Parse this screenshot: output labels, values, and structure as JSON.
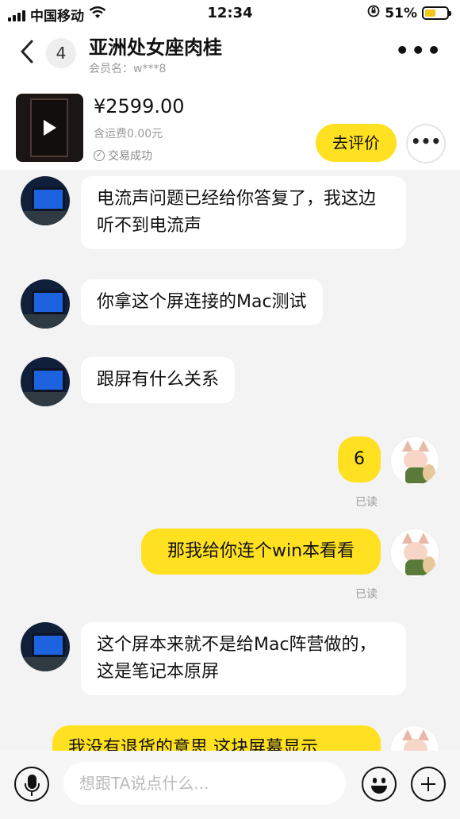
{
  "status_bar": {
    "carrier": "中国移动",
    "time": "12:34",
    "battery": "51%",
    "battery_level": 0.51
  },
  "header": {
    "unread_count": "4",
    "title": "亚洲处女座肉桂",
    "member": "会员名：w***8"
  },
  "product": {
    "price": "¥2599.00",
    "shipping": "含运费0.00元",
    "status": "交易成功",
    "review_button": "去评价"
  },
  "messages": [
    {
      "side": "left",
      "text": "电流声问题已经给你答复了，我这边听不到电流声"
    },
    {
      "side": "left",
      "text": "你拿这个屏连接的Mac测试"
    },
    {
      "side": "left",
      "text": "跟屏有什么关系"
    },
    {
      "side": "right",
      "text": "6",
      "read": "已读"
    },
    {
      "side": "right",
      "text": "那我给你连个win本看看",
      "read": "已读"
    },
    {
      "side": "left",
      "text": "这个屏本来就不是给Mac阵营做的，这是笔记本原屏"
    },
    {
      "side": "right",
      "text": "我没有退货的意思 这块屏幕显示"
    }
  ],
  "input_bar": {
    "placeholder": "想跟TA说点什么..."
  }
}
